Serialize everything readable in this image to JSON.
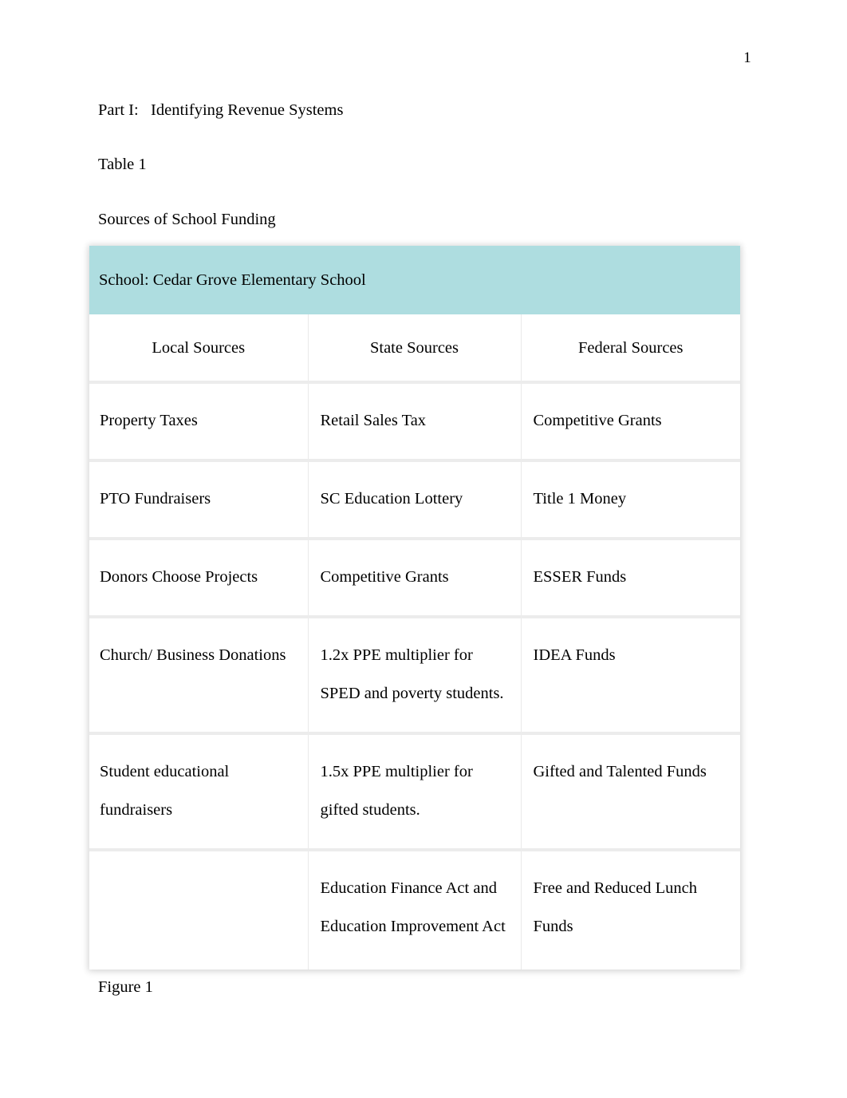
{
  "page": {
    "number": "1",
    "part_heading": "Part I:   Identifying Revenue Systems",
    "table_label": "Table 1",
    "table_title": "Sources of School Funding",
    "figure_label": "Figure 1"
  },
  "colors": {
    "table_header_band": "#aedde0",
    "row_divider": "#ececec",
    "page_background": "#ffffff",
    "text": "#000000"
  },
  "table": {
    "banner": "School: Cedar Grove Elementary School",
    "columns": [
      "Local Sources",
      "State Sources",
      "Federal Sources"
    ],
    "rows": [
      {
        "local": "Property Taxes",
        "state": "Retail Sales Tax",
        "federal": "Competitive Grants"
      },
      {
        "local": "PTO Fundraisers",
        "state": "SC Education Lottery",
        "federal": "Title 1 Money"
      },
      {
        "local": "Donors Choose Projects",
        "state": "Competitive Grants",
        "federal": "ESSER Funds"
      },
      {
        "local": "Church/ Business Donations",
        "state": " 1.2x PPE multiplier for\nSPED and poverty students.",
        "federal": "IDEA Funds"
      },
      {
        "local": " Student educational\nfundraisers",
        "state": " 1.5x PPE multiplier for\ngifted students.",
        "federal": " Gifted and Talented Funds"
      },
      {
        "local": "",
        "state": "Education Finance Act and\nEducation Improvement Act",
        "federal": "Free and Reduced Lunch\nFunds"
      }
    ]
  }
}
